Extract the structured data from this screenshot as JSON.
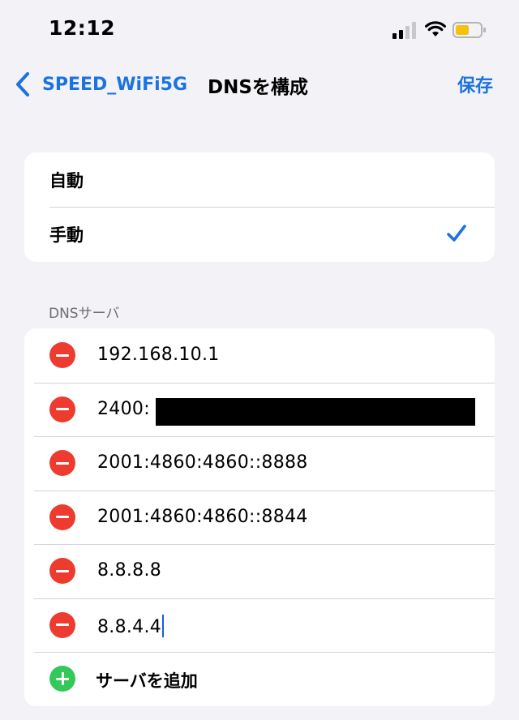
{
  "status_bar": {
    "time": "12:12",
    "battery_color": "#f4c20d"
  },
  "nav": {
    "back_label": "SPEED_WiFi5G",
    "title": "DNSを構成",
    "save_label": "保存",
    "accent_color": "#1a73e0"
  },
  "mode": {
    "options": [
      {
        "label": "自動",
        "selected": false
      },
      {
        "label": "手動",
        "selected": true
      }
    ]
  },
  "dns": {
    "section_header": "DNSサーバ",
    "servers": [
      "192.168.10.1",
      "2400:",
      "2001:4860:4860::8888",
      "2001:4860:4860::8844",
      "8.8.8.8",
      "8.8.4.4"
    ],
    "add_label": "サーバを追加"
  }
}
